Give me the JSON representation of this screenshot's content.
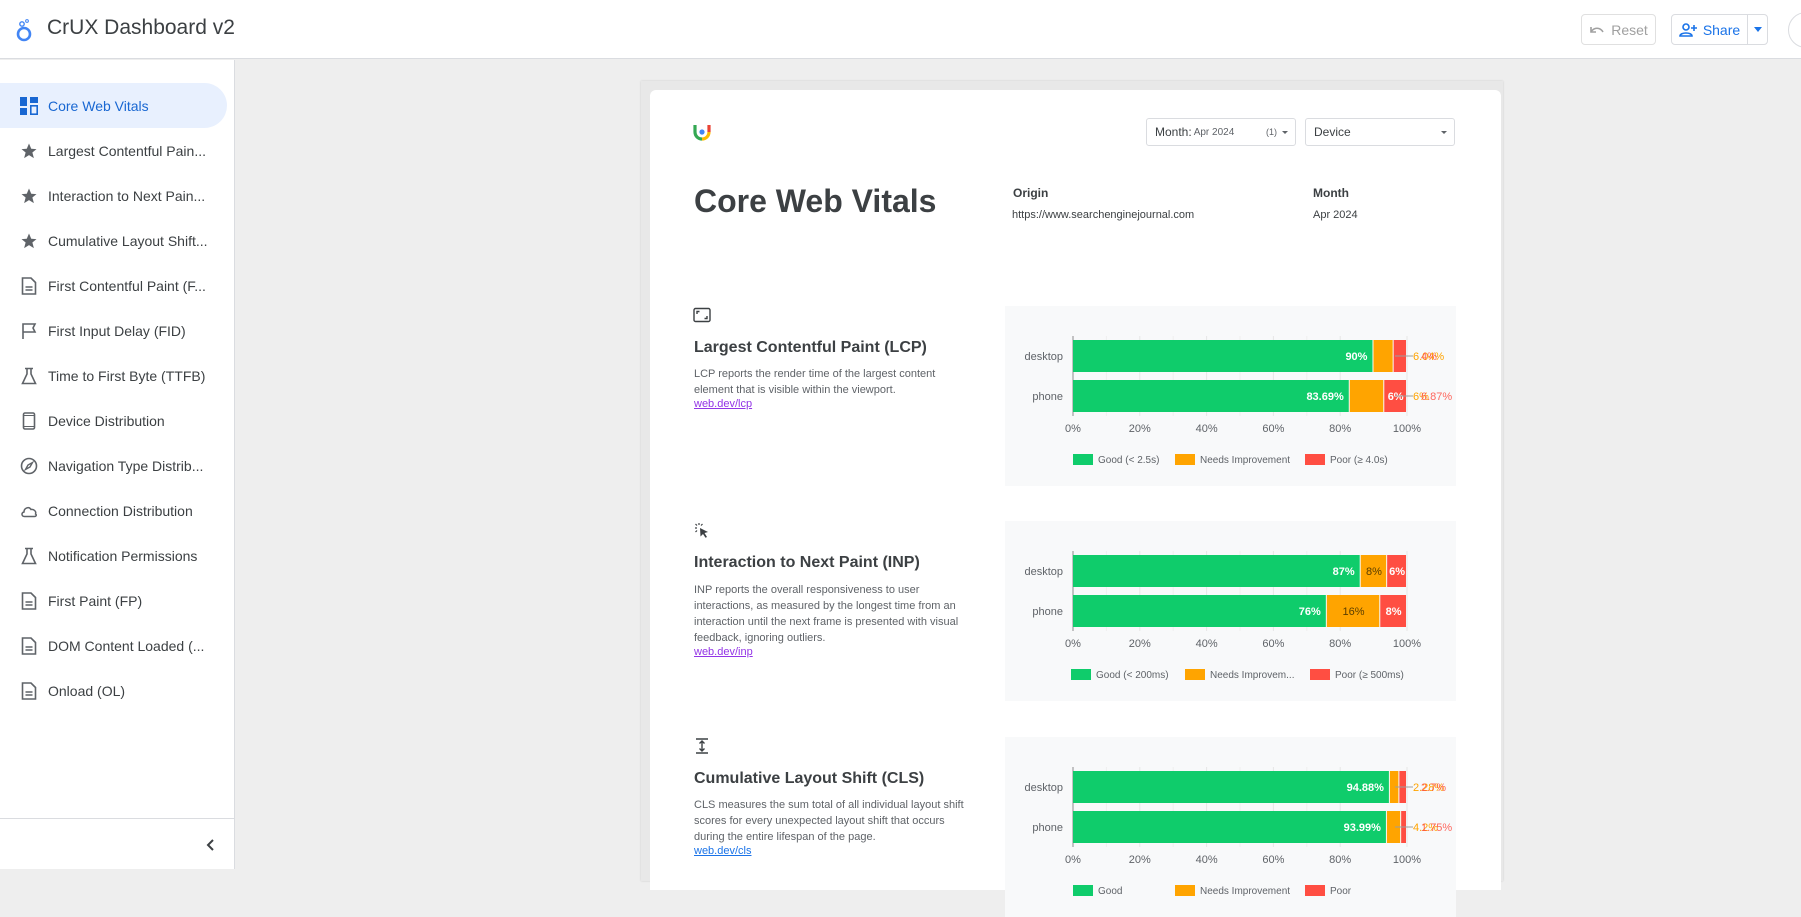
{
  "header": {
    "app_title": "CrUX Dashboard v2",
    "reset_label": "Reset",
    "share_label": "Share"
  },
  "sidebar": {
    "items": [
      {
        "label": "Core Web Vitals",
        "icon": "dashboard-icon",
        "active": true
      },
      {
        "label": "Largest Contentful Pain...",
        "icon": "star-icon"
      },
      {
        "label": "Interaction to Next Pain...",
        "icon": "star-icon"
      },
      {
        "label": "Cumulative Layout Shift...",
        "icon": "star-icon"
      },
      {
        "label": "First Contentful Paint (F...",
        "icon": "document-icon"
      },
      {
        "label": "First Input Delay (FID)",
        "icon": "flag-icon"
      },
      {
        "label": "Time to First Byte (TTFB)",
        "icon": "flask-icon"
      },
      {
        "label": "Device Distribution",
        "icon": "phone-icon"
      },
      {
        "label": "Navigation Type Distrib...",
        "icon": "compass-icon"
      },
      {
        "label": "Connection Distribution",
        "icon": "cloud-icon"
      },
      {
        "label": "Notification Permissions",
        "icon": "flask-icon"
      },
      {
        "label": "First Paint (FP)",
        "icon": "document-icon"
      },
      {
        "label": "DOM Content Loaded (...",
        "icon": "document-icon"
      },
      {
        "label": "Onload (OL)",
        "icon": "document-icon"
      }
    ]
  },
  "report": {
    "title": "Core Web Vitals",
    "filters": {
      "month_label": "Month:",
      "month_value": "Apr 2024",
      "month_count": "(1)",
      "device_label": "Device"
    },
    "origin_label": "Origin",
    "origin_value": "https://www.searchenginejournal.com",
    "month_label": "Month",
    "month_value": "Apr 2024",
    "metrics": [
      {
        "title": "Largest Contentful Paint (LCP)",
        "description": "LCP reports the render time of the largest content element that is visible within the viewport.",
        "link": "web.dev/lcp",
        "icon": "fullscreen-icon"
      },
      {
        "title": "Interaction to Next Paint (INP)",
        "description": "INP reports the overall responsiveness to user interactions, as measured by the longest time from an interaction until the next frame is presented with visual feedback, ignoring outliers.",
        "link": "web.dev/inp",
        "icon": "click-icon"
      },
      {
        "title": "Cumulative Layout Shift (CLS)",
        "description": "CLS measures the sum total of all individual layout shift scores for every unexpected layout shift that occurs during the entire lifespan of the page.",
        "link": "web.dev/cls",
        "icon": "vertical-align-icon"
      }
    ]
  },
  "colors": {
    "good": "#0fcc6b",
    "needs_improvement": "#ffa400",
    "poor": "#ff4e42",
    "accent": "#1a73e8"
  },
  "chart_data": [
    {
      "type": "bar",
      "orientation": "horizontal-stacked-100",
      "title": "Largest Contentful Paint (LCP)",
      "categories": [
        "desktop",
        "phone"
      ],
      "series": [
        {
          "name": "Good (< 2.5s)",
          "values": [
            90,
            83.69
          ],
          "labels": [
            "90%",
            "83.69%"
          ]
        },
        {
          "name": "Needs Improvement",
          "values": [
            6.04,
            10.44
          ],
          "labels": [
            "6.04%",
            "10.44%"
          ]
        },
        {
          "name": "Poor (≥ 4.0s)",
          "values": [
            4,
            6.87
          ],
          "labels": [
            "4%",
            "6%",
            "6.87%"
          ]
        }
      ],
      "outside_labels": [
        [
          "6.04%",
          "4%"
        ],
        [
          "6%",
          "6.87%"
        ]
      ],
      "xticks": [
        "0%",
        "20%",
        "40%",
        "60%",
        "80%",
        "100%"
      ],
      "xlim": [
        0,
        100
      ],
      "legend": "bottom"
    },
    {
      "type": "bar",
      "orientation": "horizontal-stacked-100",
      "title": "Interaction to Next Paint (INP)",
      "categories": [
        "desktop",
        "phone"
      ],
      "series": [
        {
          "name": "Good (< 200ms)",
          "values": [
            87,
            76
          ],
          "labels": [
            "87%",
            "76%"
          ]
        },
        {
          "name": "Needs Improvem...",
          "values": [
            8,
            16
          ],
          "labels": [
            "8%",
            "16%"
          ]
        },
        {
          "name": "Poor (≥ 500ms)",
          "values": [
            6,
            8
          ],
          "labels": [
            "6%",
            "8%"
          ]
        }
      ],
      "xticks": [
        "0%",
        "20%",
        "40%",
        "60%",
        "80%",
        "100%"
      ],
      "xlim": [
        0,
        100
      ],
      "legend": "bottom"
    },
    {
      "type": "bar",
      "orientation": "horizontal-stacked-100",
      "title": "Cumulative Layout Shift (CLS)",
      "categories": [
        "desktop",
        "phone"
      ],
      "series": [
        {
          "name": "Good",
          "values": [
            94.88,
            93.99
          ],
          "labels": [
            "94.88%",
            "93.99%"
          ]
        },
        {
          "name": "Needs Improvement",
          "values": [
            2.84,
            4.26
          ],
          "labels": [
            "2.8%",
            "4.2%"
          ]
        },
        {
          "name": "Poor",
          "values": [
            2.28,
            1.75
          ],
          "labels": [
            "2.3%",
            "1.75%"
          ]
        }
      ],
      "outside_labels": [
        [
          "2.28%",
          "2.7%"
        ],
        [
          "4.2%",
          "1.75%"
        ]
      ],
      "xticks": [
        "0%",
        "20%",
        "40%",
        "60%",
        "80%",
        "100%"
      ],
      "xlim": [
        0,
        100
      ],
      "legend": "bottom"
    }
  ]
}
